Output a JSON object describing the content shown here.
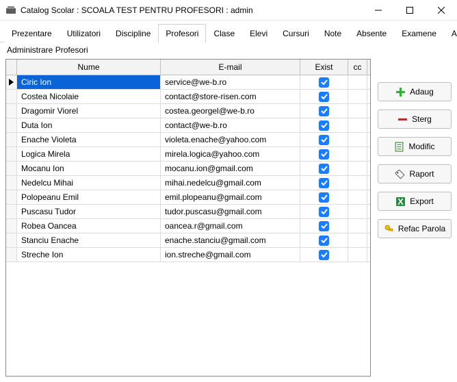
{
  "window": {
    "title": "Catalog Scolar : SCOALA TEST PENTRU PROFESORI : admin"
  },
  "tabs": {
    "items": [
      "Prezentare",
      "Utilizatori",
      "Discipline",
      "Profesori",
      "Clase",
      "Elevi",
      "Cursuri",
      "Note",
      "Absente",
      "Examene",
      "Audit"
    ],
    "active_index": 3
  },
  "subheader": "Administrare Profesori",
  "grid": {
    "columns": {
      "nume": "Nume",
      "email": "E-mail",
      "exist": "Exist",
      "cc": "cc"
    },
    "rows": [
      {
        "nume": "Ciric Ion",
        "email": "service@we-b.ro",
        "exist": true,
        "selected": true
      },
      {
        "nume": "Costea Nicolaie",
        "email": "contact@store-risen.com",
        "exist": true
      },
      {
        "nume": "Dragomir Viorel",
        "email": "costea.georgel@we-b.ro",
        "exist": true
      },
      {
        "nume": "Duta Ion",
        "email": "contact@we-b.ro",
        "exist": true
      },
      {
        "nume": "Enache Violeta",
        "email": "violeta.enache@yahoo.com",
        "exist": true
      },
      {
        "nume": "Logica Mirela",
        "email": "mirela.logica@yahoo.com",
        "exist": true
      },
      {
        "nume": "Mocanu Ion",
        "email": "mocanu.ion@gmail.com",
        "exist": true
      },
      {
        "nume": "Nedelcu Mihai",
        "email": "mihai.nedelcu@gmail.com",
        "exist": true
      },
      {
        "nume": "Polopeanu Emil",
        "email": "emil.plopeanu@gmail.com",
        "exist": true
      },
      {
        "nume": "Puscasu Tudor",
        "email": "tudor.puscasu@gmail.com",
        "exist": true
      },
      {
        "nume": "Robea Oancea",
        "email": "oancea.r@gmail.com",
        "exist": true
      },
      {
        "nume": "Stanciu Enache",
        "email": "enache.stanciu@gmail.com",
        "exist": true
      },
      {
        "nume": "Streche Ion",
        "email": "ion.streche@gmail.com",
        "exist": true
      }
    ]
  },
  "buttons": {
    "adaug": "Adaug",
    "sterg": "Sterg",
    "modific": "Modific",
    "raport": "Raport",
    "export": "Export",
    "refac": "Refac Parola"
  }
}
